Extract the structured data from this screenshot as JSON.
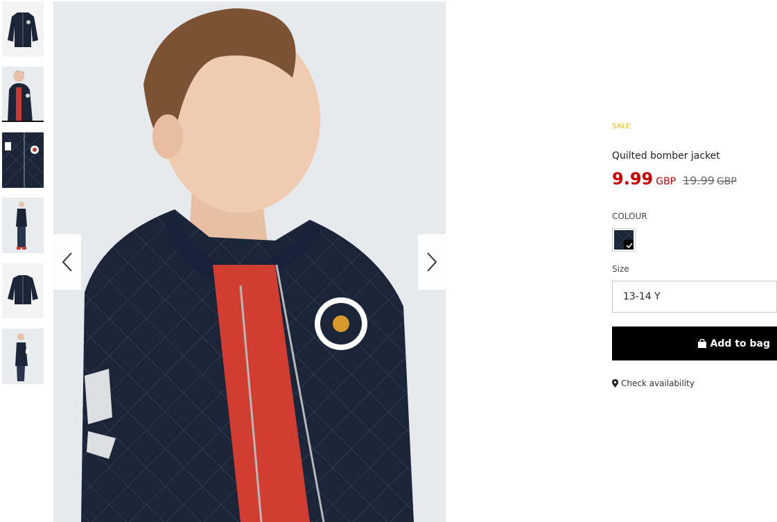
{
  "product": {
    "badge": "SALE",
    "title": "Quilted bomber jacket",
    "price": "9.99",
    "currency": "GBP",
    "old_price": "19.99",
    "old_currency": "GBP"
  },
  "colour": {
    "label": "COLOUR",
    "selected_swatch": "navy"
  },
  "size": {
    "label": "Size",
    "selected": "13-14 Y"
  },
  "actions": {
    "add_to_bag": "Add to bag",
    "check_availability": "Check availability"
  },
  "gallery": {
    "thumbnail_count": 6,
    "active_thumbnail": 2
  },
  "colors": {
    "sale_yellow": "#f2b51b",
    "price_red": "#cc0000",
    "navy": "#1b2538",
    "button_black": "#000000"
  }
}
